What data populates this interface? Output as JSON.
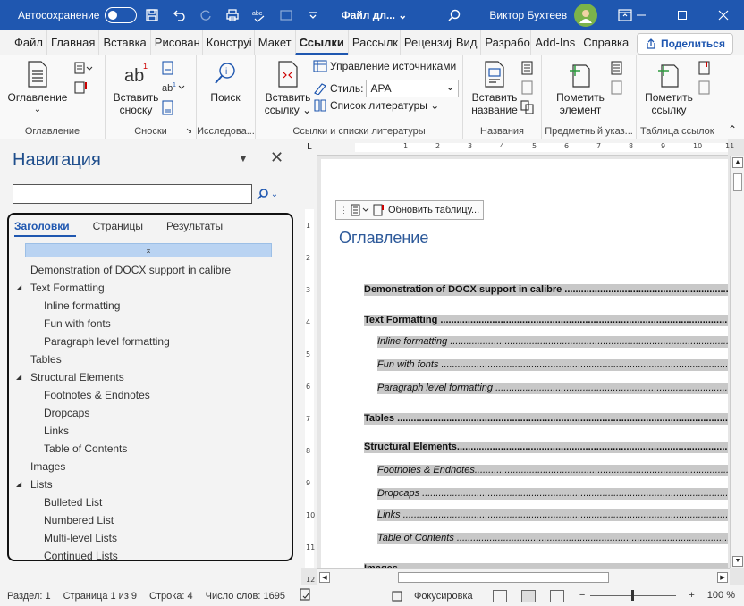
{
  "titlebar": {
    "autosave_label": "Автосохранение",
    "doc_title": "Файл дл... ⌄",
    "user_name": "Виктор Бухтеев"
  },
  "ribbon_tabs": [
    "Файл",
    "Главная",
    "Вставка",
    "Рисован",
    "Конструі",
    "Макет",
    "Ссылки",
    "Рассылк",
    "Рецензиј",
    "Вид",
    "Разрабо",
    "Add-Ins",
    "Справка"
  ],
  "active_tab": "Ссылки",
  "share_label": "Поделиться",
  "ribbon": {
    "toc_group": {
      "label": "Оглавление",
      "btn": "Оглавление"
    },
    "footnotes_group": {
      "label": "Сноски",
      "btn_line1": "Вставить",
      "btn_line2": "сноску",
      "icon_text": "ab"
    },
    "research_group": {
      "label": "Исследова...",
      "btn": "Поиск"
    },
    "citations_group": {
      "label": "Ссылки и списки литературы",
      "btn_line1": "Вставить",
      "btn_line2": "ссылку ⌄",
      "manage_sources": "Управление источниками",
      "style_label": "Стиль:",
      "style_value": "APA",
      "bibliography": "Список литературы ⌄"
    },
    "captions_group": {
      "label": "Названия",
      "btn_line1": "Вставить",
      "btn_line2": "название"
    },
    "index_group": {
      "label": "Предметный указ...",
      "btn_line1": "Пометить",
      "btn_line2": "элемент"
    },
    "authorities_group": {
      "label": "Таблица ссылок",
      "btn_line1": "Пометить",
      "btn_line2": "ссылку"
    }
  },
  "nav": {
    "title": "Навигация",
    "search_placeholder": "",
    "tabs": [
      "Заголовки",
      "Страницы",
      "Результаты"
    ],
    "active_tab": "Заголовки",
    "collapse_glyph": "⌅",
    "items": [
      {
        "text": "Demonstration of DOCX support in calibre",
        "level": 1,
        "expander": false
      },
      {
        "text": "Text Formatting",
        "level": 1,
        "expander": true
      },
      {
        "text": "Inline formatting",
        "level": 2,
        "expander": false
      },
      {
        "text": "Fun with fonts",
        "level": 2,
        "expander": false
      },
      {
        "text": "Paragraph level formatting",
        "level": 2,
        "expander": false
      },
      {
        "text": "Tables",
        "level": 1,
        "expander": false
      },
      {
        "text": "Structural Elements",
        "level": 1,
        "expander": true
      },
      {
        "text": "Footnotes & Endnotes",
        "level": 2,
        "expander": false
      },
      {
        "text": "Dropcaps",
        "level": 2,
        "expander": false
      },
      {
        "text": "Links",
        "level": 2,
        "expander": false
      },
      {
        "text": "Table of Contents",
        "level": 2,
        "expander": false
      },
      {
        "text": "Images",
        "level": 1,
        "expander": false
      },
      {
        "text": "Lists",
        "level": 1,
        "expander": true
      },
      {
        "text": "Bulleted List",
        "level": 2,
        "expander": false
      },
      {
        "text": "Numbered List",
        "level": 2,
        "expander": false
      },
      {
        "text": "Multi-level Lists",
        "level": 2,
        "expander": false
      },
      {
        "text": "Continued Lists",
        "level": 2,
        "expander": false
      }
    ]
  },
  "ruler_numbers": [
    "1",
    "2",
    "3",
    "4",
    "5",
    "6",
    "7",
    "8",
    "9",
    "10",
    "11"
  ],
  "vruler_numbers": [
    "1",
    "2",
    "3",
    "4",
    "5",
    "6",
    "7",
    "8",
    "9",
    "10",
    "11",
    "12"
  ],
  "document": {
    "toc_update_label": "Обновить таблицу...",
    "toc_heading": "Оглавление",
    "toc_entries": [
      {
        "text": "Demonstration of DOCX support in calibre ......................................................................",
        "level": 1
      },
      {
        "text": "Text Formatting ...................................................................................................................",
        "level": 1
      },
      {
        "text": "Inline formatting ...............................................................................................................",
        "level": 2
      },
      {
        "text": "Fun with fonts ....................................................................................................................",
        "level": 2
      },
      {
        "text": "Paragraph level formatting .................................................................................................",
        "level": 2
      },
      {
        "text": "Tables .................................................................................................................................",
        "level": 1
      },
      {
        "text": "Structural Elements................................................................................................................",
        "level": 1
      },
      {
        "text": "Footnotes & Endnotes...........................................................................................................",
        "level": 2
      },
      {
        "text": "Dropcaps ............................................................................................................................",
        "level": 2
      },
      {
        "text": "Links .................................................................................................................................",
        "level": 2
      },
      {
        "text": "Table of Contents ................................................................................................................",
        "level": 2
      },
      {
        "text": "Images ..............................................................................................................................",
        "level": 1
      }
    ]
  },
  "status": {
    "section": "Раздел: 1",
    "page": "Страница 1 из 9",
    "line": "Строка: 4",
    "words": "Число слов: 1695",
    "focus": "Фокусировка",
    "zoom_minus": "−",
    "zoom_plus": "+",
    "zoom_level": "100 %"
  },
  "colors": {
    "titlebar": "#1f57b0",
    "accent": "#1f57b0",
    "nav_title": "#1f4e8c",
    "toc_highlight": "#c8c8c8"
  }
}
